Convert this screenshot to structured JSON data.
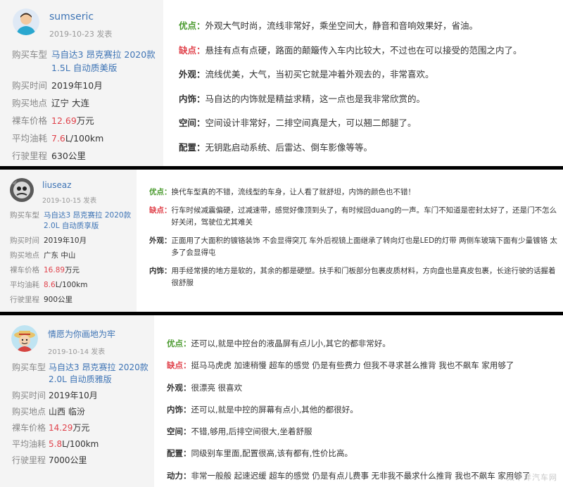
{
  "reviews": [
    {
      "user": {
        "name": "sumseric",
        "date": "2019-10-23 发表"
      },
      "specs": {
        "model": {
          "key": "购买车型",
          "value": "马自达3 昂克赛拉 2020款 1.5L 自动质美版"
        },
        "time": {
          "key": "购买时间",
          "value": "2019年10月"
        },
        "place": {
          "key": "购买地点",
          "value": "辽宁 大连"
        },
        "price": {
          "key": "裸车价格",
          "num": "12.69",
          "unit": "万元"
        },
        "fuel": {
          "key": "平均油耗",
          "num": "7.6",
          "unit": "L/100km"
        },
        "mileage": {
          "key": "行驶里程",
          "value": "630公里"
        }
      },
      "lines": [
        {
          "label": "优点：",
          "text": "外观大气时尚，流线非常好，乘坐空间大，静音和音响效果好，省油。"
        },
        {
          "label": "缺点：",
          "text": "悬挂有点有点硬，路面的颠簸传入车内比较大，不过也在可以接受的范围之内了。"
        },
        {
          "label": "外观：",
          "text": "流线优美，大气，当初买它就是冲着外观去的，非常喜欢。"
        },
        {
          "label": "内饰：",
          "text": "马自达的内饰就是精益求精，这一点也是我非常欣赏的。"
        },
        {
          "label": "空间：",
          "text": "空间设计非常好，二排空间真是大，可以翘二郎腿了。"
        },
        {
          "label": "配置：",
          "text": "无钥匙启动系统、后雷达、倒车影像等等。"
        }
      ]
    },
    {
      "user": {
        "name": "liuseaz",
        "date": "2019-10-15 发表"
      },
      "specs": {
        "model": {
          "key": "购买车型",
          "value": "马自达3 昂克赛拉 2020款 2.0L 自动质享版"
        },
        "time": {
          "key": "购买时间",
          "value": "2019年10月"
        },
        "place": {
          "key": "购买地点",
          "value": "广东 中山"
        },
        "price": {
          "key": "裸车价格",
          "num": "16.89",
          "unit": "万元"
        },
        "fuel": {
          "key": "平均油耗",
          "num": "8.6",
          "unit": "L/100km"
        },
        "mileage": {
          "key": "行驶里程",
          "value": "900公里"
        }
      },
      "lines": [
        {
          "label": "优点：",
          "text": "换代车型真的不错，流线型的车身，让人看了就舒坦，内饰的颜色也不错！"
        },
        {
          "label": "缺点：",
          "text": "行车时候减震偏硬，过减速带，感觉好像顶到头了，有时候回duang的一声。车门不知道是密封太好了，还是门不怎么好关闭，驾驶位尤其难关"
        },
        {
          "label": "外观：",
          "text": "正面用了大面积的镀铬装饰 不会显得突兀 车外后视镜上面继承了转向灯也是LED的灯带 两侧车玻璃下面有少量镀铬 太多了会显得屯"
        },
        {
          "label": "内饰：",
          "text": "用手经常摸的地方是软的，其余的都是硬塑。扶手和门板部分包裹皮质材料，方向盘也是真皮包裹，长途行驶的话握着很舒服"
        }
      ]
    },
    {
      "user": {
        "name": "情愿为你画地为牢",
        "date": "2019-10-14 发表"
      },
      "specs": {
        "model": {
          "key": "购买车型",
          "value": "马自达3 昂克赛拉 2020款 2.0L 自动质雅版"
        },
        "time": {
          "key": "购买时间",
          "value": "2019年10月"
        },
        "place": {
          "key": "购买地点",
          "value": "山西 临汾"
        },
        "price": {
          "key": "裸车价格",
          "num": "14.29",
          "unit": "万元"
        },
        "fuel": {
          "key": "平均油耗",
          "num": "5.8",
          "unit": "L/100km"
        },
        "mileage": {
          "key": "行驶里程",
          "value": "7000公里"
        }
      },
      "lines": [
        {
          "label": "优点：",
          "text": "还可以,就是中控台的液晶屏有点儿小,其它的都非常好。"
        },
        {
          "label": "缺点：",
          "text": "挺马马虎虎 加速稍慢 超车的感觉 仍是有些费力 但我不寻求甚么推背 我也不飙车 家用够了"
        },
        {
          "label": "外观：",
          "text": "很漂亮 很喜欢"
        },
        {
          "label": "内饰：",
          "text": "还可以,就是中控的屏幕有点小,其他的都很好。"
        },
        {
          "label": "空间：",
          "text": "不错,够用,后排空间很大,坐着舒服"
        },
        {
          "label": "配置：",
          "text": "同级别车里面,配置很高,该有都有,性价比高。"
        },
        {
          "label": "动力：",
          "text": "非常一般般 起速迟缓 超车的感觉 仍是有点儿费事 无非我不最求什么推背 我也不飙车 家用够了"
        }
      ]
    }
  ],
  "watermark": "太平洋汽车网",
  "colors": {
    "link": "#3e74b5",
    "good": "#4a9a2e",
    "bad": "#e0434c"
  }
}
